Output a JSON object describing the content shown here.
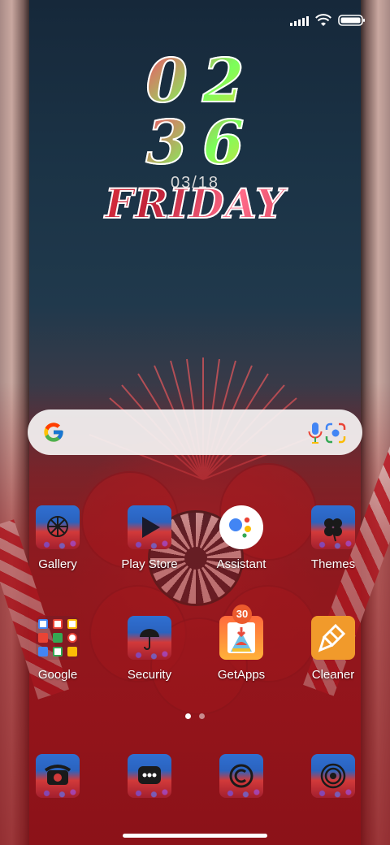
{
  "status_bar": {
    "icons": [
      "signal-icon",
      "wifi-icon",
      "battery-icon"
    ]
  },
  "clock": {
    "hours": "02",
    "minutes": "36",
    "date": "03/18",
    "day": "FRIDAY"
  },
  "search": {
    "icons": [
      "google-g-icon",
      "mic-icon",
      "lens-icon"
    ]
  },
  "apps_row1": [
    {
      "label": "Gallery",
      "icon": "gallery-icon"
    },
    {
      "label": "Play Store",
      "icon": "play-store-icon"
    },
    {
      "label": "Assistant",
      "icon": "assistant-icon"
    },
    {
      "label": "Themes",
      "icon": "themes-icon"
    }
  ],
  "apps_row2": [
    {
      "label": "Google",
      "icon": "google-folder-icon"
    },
    {
      "label": "Security",
      "icon": "security-icon"
    },
    {
      "label": "GetApps",
      "icon": "getapps-icon",
      "badge": "30"
    },
    {
      "label": "Cleaner",
      "icon": "cleaner-icon"
    }
  ],
  "page_indicator": {
    "pages": 2,
    "current": 1
  },
  "dock": [
    {
      "icon": "phone-icon"
    },
    {
      "icon": "messages-icon"
    },
    {
      "icon": "browser-icon"
    },
    {
      "icon": "camera-icon"
    }
  ],
  "colors": {
    "badge": "#ec5b2d",
    "cleaner": "#f19a2b"
  }
}
